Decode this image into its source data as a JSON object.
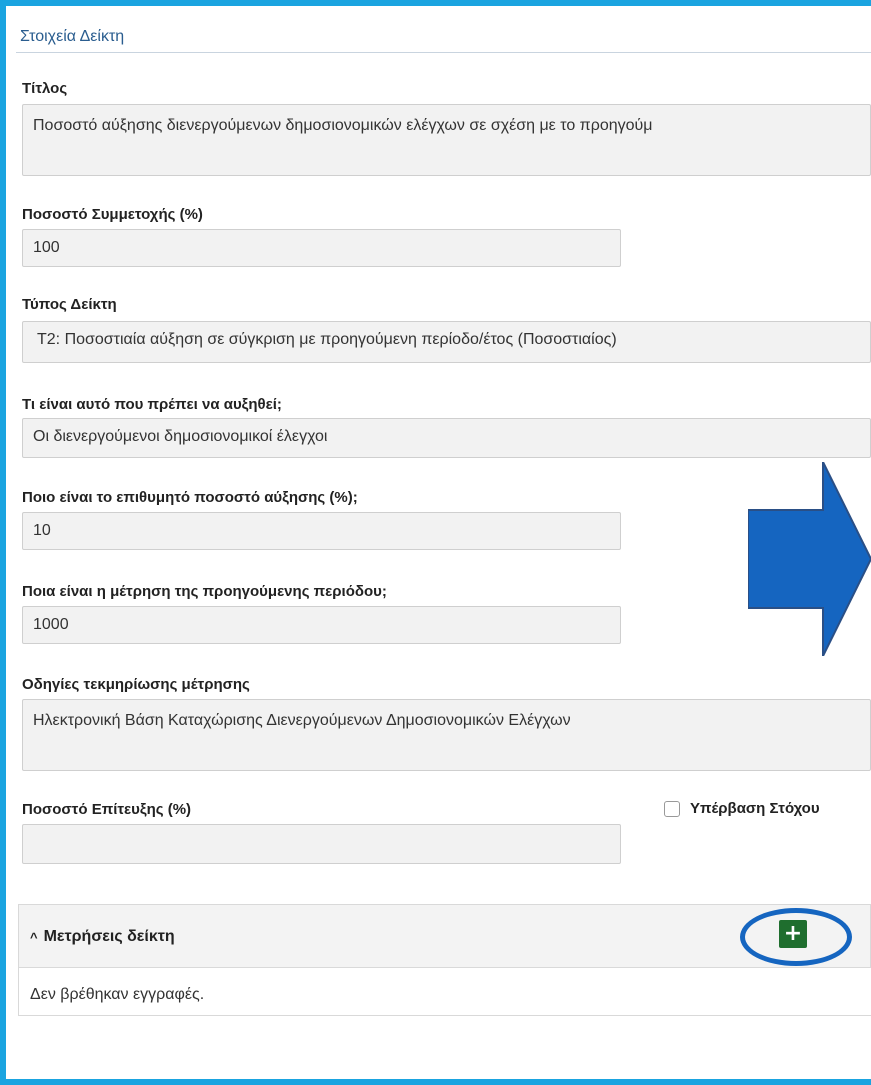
{
  "section": {
    "title": "Στοιχεία Δείκτη"
  },
  "fields": {
    "title": {
      "label": "Τίτλος",
      "value": "Ποσοστό αύξησης διενεργούμενων δημοσιονομικών ελέγχων σε σχέση με το προηγούμ"
    },
    "participation": {
      "label": "Ποσοστό Συμμετοχής (%)",
      "value": "100"
    },
    "indicator_type": {
      "label": "Τύπος Δείκτη",
      "value": "T2: Ποσοστιαία αύξηση σε σύγκριση με προηγούμενη περίοδο/έτος (Ποσοστιαίος)"
    },
    "what_increase": {
      "label": "Τι είναι αυτό που πρέπει να αυξηθεί;",
      "value": "Οι διενεργούμενοι δημοσιονομικοί έλεγχοι"
    },
    "target_increase": {
      "label": "Ποιο είναι το επιθυμητό ποσοστό αύξησης (%);",
      "value": "10"
    },
    "previous_measurement": {
      "label": "Ποια είναι η μέτρηση της προηγούμενης περιόδου;",
      "value": "1000"
    },
    "documentation": {
      "label": "Οδηγίες τεκμηρίωσης μέτρησης",
      "value": "Ηλεκτρονική Βάση Καταχώρισης Διενεργούμενων Δημοσιονομικών Ελέγχων"
    },
    "achievement": {
      "label": "Ποσοστό Επίτευξης (%)",
      "value": ""
    }
  },
  "target_exceeded": {
    "label": "Υπέρβαση Στόχου",
    "checked": false
  },
  "measurements": {
    "title": "Μετρήσεις δείκτη",
    "chevron_icon": "chevron-up-icon",
    "add_icon": "plus-icon",
    "empty_text": "Δεν βρέθηκαν εγγραφές."
  },
  "colors": {
    "frame": "#1aa4e0",
    "arrow": "#1565c0",
    "add_button": "#1f6e2e",
    "section_title": "#2a5d8f"
  }
}
